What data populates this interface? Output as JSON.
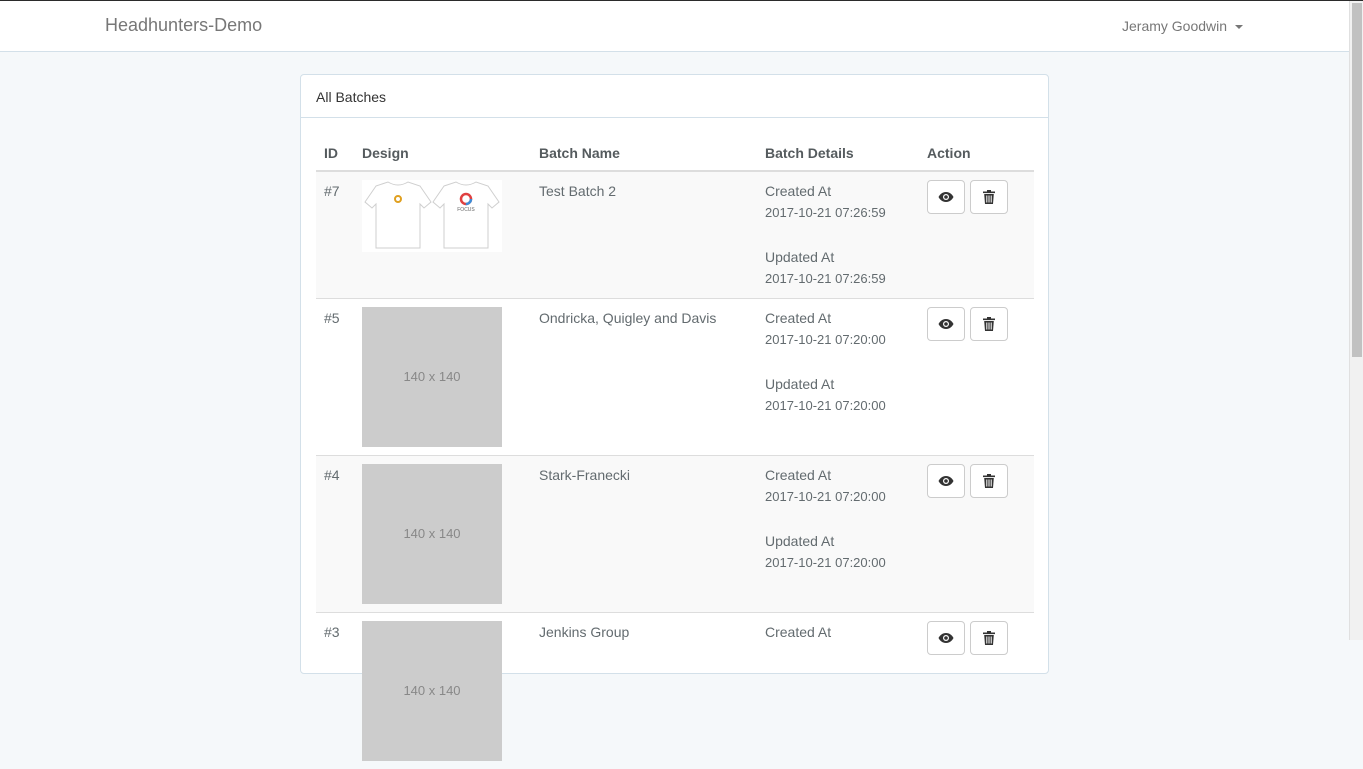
{
  "navbar": {
    "brand": "Headhunters-Demo",
    "user_name": "Jeramy Goodwin"
  },
  "panel": {
    "title": "All Batches"
  },
  "table": {
    "headers": [
      "ID",
      "Design",
      "Batch Name",
      "Batch Details",
      "Action"
    ],
    "created_label": "Created At",
    "updated_label": "Updated At",
    "rows": [
      {
        "id": "#7",
        "design": "t-shirt-mockups",
        "design_text": "",
        "name": "Test Batch 2",
        "created": "2017-10-21 07:26:59",
        "updated": "2017-10-21 07:26:59"
      },
      {
        "id": "#5",
        "design": "placeholder",
        "design_text": "140 x 140",
        "name": "Ondricka, Quigley and Davis",
        "created": "2017-10-21 07:20:00",
        "updated": "2017-10-21 07:20:00"
      },
      {
        "id": "#4",
        "design": "placeholder",
        "design_text": "140 x 140",
        "name": "Stark-Franecki",
        "created": "2017-10-21 07:20:00",
        "updated": "2017-10-21 07:20:00"
      },
      {
        "id": "#3",
        "design": "placeholder",
        "design_text": "140 x 140",
        "name": "Jenkins Group",
        "created": "",
        "updated": ""
      }
    ]
  },
  "icons": {
    "view": "eye-icon",
    "delete": "trash-icon"
  }
}
